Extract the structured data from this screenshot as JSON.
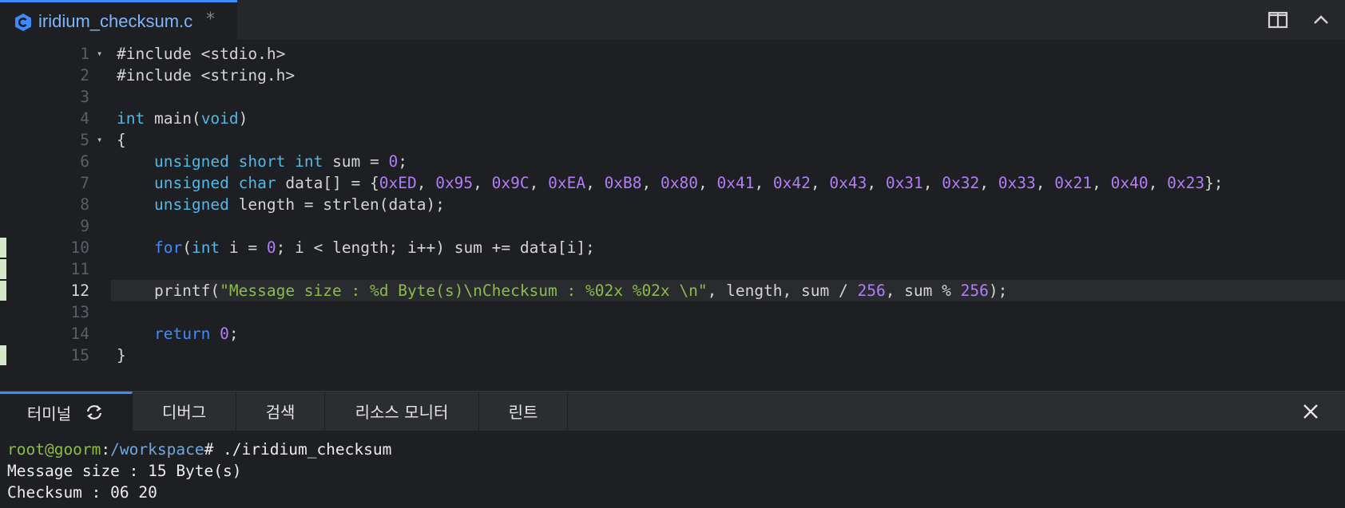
{
  "editor_tab": {
    "file_name": "iridium_checksum.c",
    "dirty_marker": "*",
    "icon": "c-language-icon"
  },
  "toolbar": {
    "split_icon": "split-editor-icon",
    "collapse_icon": "chevron-up-icon"
  },
  "code_lines": [
    {
      "num": "1",
      "fold": "▾",
      "tokens": [
        [
          "pl",
          "#include <stdio.h>"
        ]
      ]
    },
    {
      "num": "2",
      "tokens": [
        [
          "pl",
          "#include <string.h>"
        ]
      ]
    },
    {
      "num": "3",
      "tokens": []
    },
    {
      "num": "4",
      "tokens": [
        [
          "kw",
          "int"
        ],
        [
          "pl",
          " main("
        ],
        [
          "kw",
          "void"
        ],
        [
          "pl",
          ")"
        ]
      ]
    },
    {
      "num": "5",
      "fold": "▾",
      "tokens": [
        [
          "pl",
          "{"
        ]
      ]
    },
    {
      "num": "6",
      "tokens": [
        [
          "pl",
          "    "
        ],
        [
          "kw",
          "unsigned"
        ],
        [
          "pl",
          " "
        ],
        [
          "kw",
          "short"
        ],
        [
          "pl",
          " "
        ],
        [
          "kw",
          "int"
        ],
        [
          "pl",
          " sum = "
        ],
        [
          "num",
          "0"
        ],
        [
          "pl",
          ";"
        ]
      ]
    },
    {
      "num": "7",
      "tokens": [
        [
          "pl",
          "    "
        ],
        [
          "kw",
          "unsigned"
        ],
        [
          "pl",
          " "
        ],
        [
          "kw",
          "char"
        ],
        [
          "pl",
          " data[] = {"
        ],
        [
          "num",
          "0xED"
        ],
        [
          "pl",
          ", "
        ],
        [
          "num",
          "0x95"
        ],
        [
          "pl",
          ", "
        ],
        [
          "num",
          "0x9C"
        ],
        [
          "pl",
          ", "
        ],
        [
          "num",
          "0xEA"
        ],
        [
          "pl",
          ", "
        ],
        [
          "num",
          "0xB8"
        ],
        [
          "pl",
          ", "
        ],
        [
          "num",
          "0x80"
        ],
        [
          "pl",
          ", "
        ],
        [
          "num",
          "0x41"
        ],
        [
          "pl",
          ", "
        ],
        [
          "num",
          "0x42"
        ],
        [
          "pl",
          ", "
        ],
        [
          "num",
          "0x43"
        ],
        [
          "pl",
          ", "
        ],
        [
          "num",
          "0x31"
        ],
        [
          "pl",
          ", "
        ],
        [
          "num",
          "0x32"
        ],
        [
          "pl",
          ", "
        ],
        [
          "num",
          "0x33"
        ],
        [
          "pl",
          ", "
        ],
        [
          "num",
          "0x21"
        ],
        [
          "pl",
          ", "
        ],
        [
          "num",
          "0x40"
        ],
        [
          "pl",
          ", "
        ],
        [
          "num",
          "0x23"
        ],
        [
          "pl",
          "};"
        ]
      ]
    },
    {
      "num": "8",
      "tokens": [
        [
          "pl",
          "    "
        ],
        [
          "kw",
          "unsigned"
        ],
        [
          "pl",
          " length = strlen(data);"
        ]
      ]
    },
    {
      "num": "9",
      "tokens": []
    },
    {
      "num": "10",
      "mark": true,
      "tokens": [
        [
          "pl",
          "    "
        ],
        [
          "kw2",
          "for"
        ],
        [
          "pl",
          "("
        ],
        [
          "kw",
          "int"
        ],
        [
          "pl",
          " i = "
        ],
        [
          "num",
          "0"
        ],
        [
          "pl",
          "; i < length; i++) sum += data[i];"
        ]
      ]
    },
    {
      "num": "11",
      "mark": true,
      "tokens": []
    },
    {
      "num": "12",
      "mark": true,
      "current": true,
      "tokens": [
        [
          "pl",
          "    printf("
        ],
        [
          "str",
          "\"Message size : %d Byte(s)\\nChecksum : %02x %02x \\n\""
        ],
        [
          "pl",
          ", length, sum / "
        ],
        [
          "num",
          "256"
        ],
        [
          "pl",
          ", sum % "
        ],
        [
          "num",
          "256"
        ],
        [
          "pl",
          ");"
        ]
      ]
    },
    {
      "num": "13",
      "tokens": []
    },
    {
      "num": "14",
      "tokens": [
        [
          "pl",
          "    "
        ],
        [
          "kw2",
          "return"
        ],
        [
          "pl",
          " "
        ],
        [
          "num",
          "0"
        ],
        [
          "pl",
          ";"
        ]
      ]
    },
    {
      "num": "15",
      "mark": true,
      "tokens": [
        [
          "pl",
          "}"
        ]
      ]
    }
  ],
  "panel_tabs": [
    {
      "label": "터미널",
      "icon": "refresh-icon",
      "active": true
    },
    {
      "label": "디버그"
    },
    {
      "label": "검색"
    },
    {
      "label": "리소스 모니터"
    },
    {
      "label": "린트"
    }
  ],
  "panel_close_icon": "close-icon",
  "terminal": {
    "prompt_user": "root@goorm",
    "prompt_sep": ":",
    "prompt_path": "/workspace",
    "prompt_end": "# ",
    "command": "./iridium_checksum",
    "output": [
      "Message size : 15 Byte(s)",
      "Checksum : 06 20"
    ]
  },
  "colors": {
    "accent": "#3d8bfd",
    "keyword": "#4fb8e8",
    "number": "#b07ef8",
    "string": "#8dbb4a",
    "background": "#1e1f22"
  }
}
